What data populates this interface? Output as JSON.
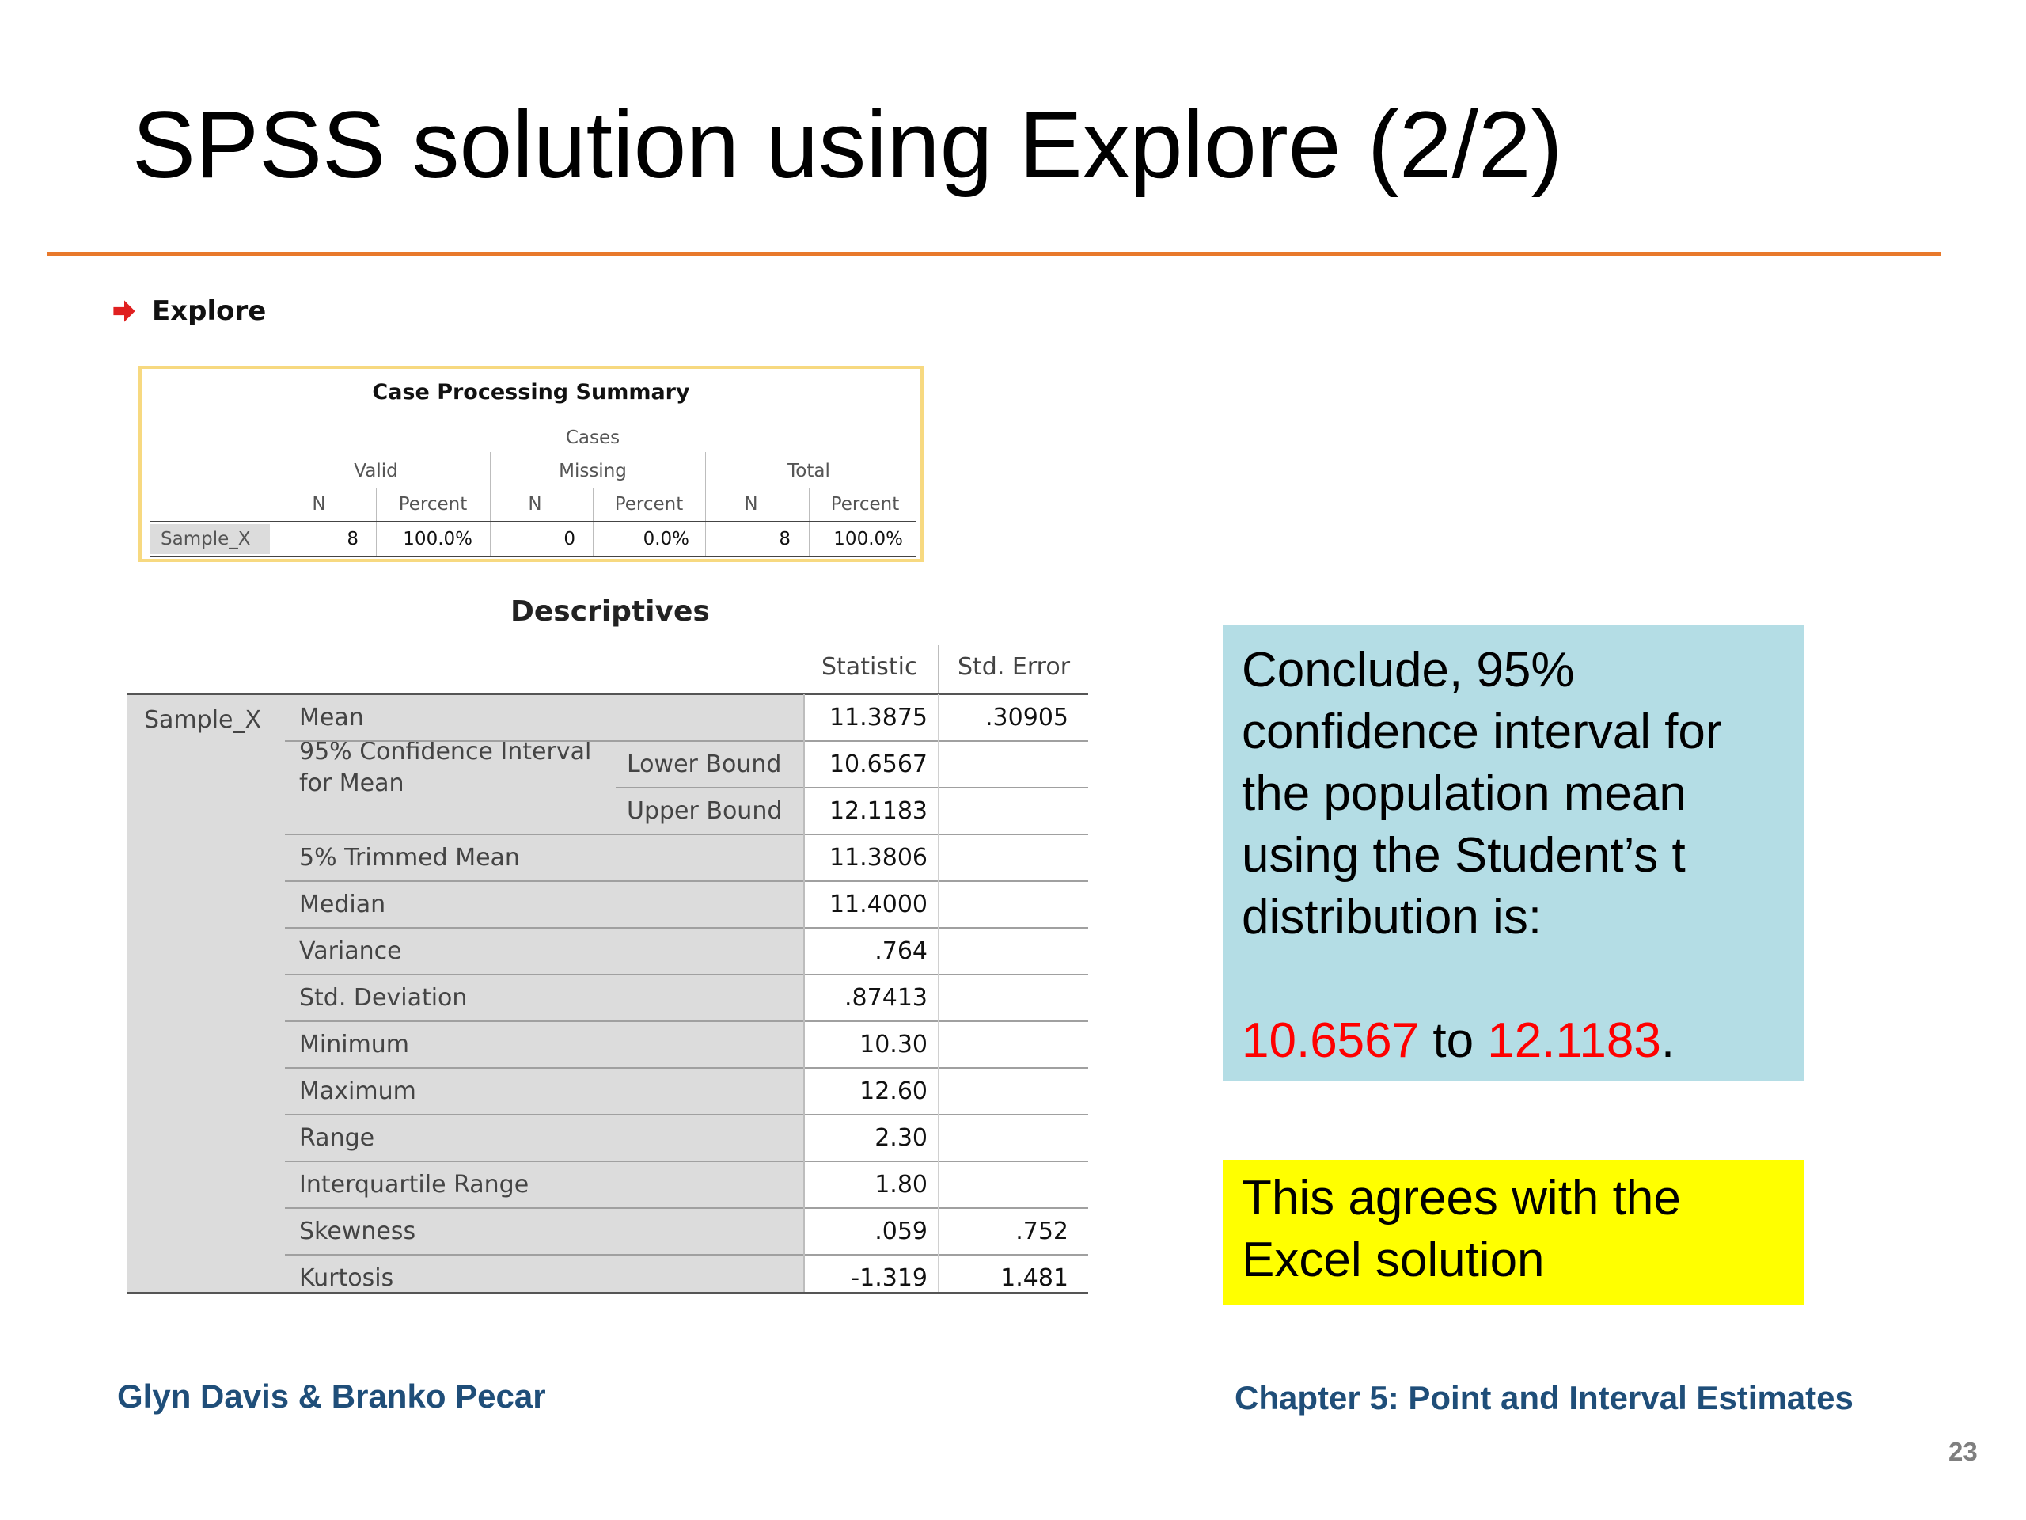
{
  "slide": {
    "title": "SPSS solution using Explore (2/2)",
    "accent_color": "#e8792b"
  },
  "explore": {
    "heading": "Explore",
    "icon": "red-arrow-icon"
  },
  "case_processing": {
    "title": "Case Processing Summary",
    "cases_label": "Cases",
    "groups": [
      "Valid",
      "Missing",
      "Total"
    ],
    "sub_headers": [
      "N",
      "Percent",
      "N",
      "Percent",
      "N",
      "Percent"
    ],
    "row_label": "Sample_X",
    "values": [
      "8",
      "100.0%",
      "0",
      "0.0%",
      "8",
      "100.0%"
    ]
  },
  "descriptives": {
    "title": "Descriptives",
    "col_statistic": "Statistic",
    "col_std_error": "Std. Error",
    "variable": "Sample_X",
    "ci_label_line1": "95% Confidence Interval",
    "ci_label_line2": "for Mean",
    "rows": [
      {
        "label": "Mean",
        "statistic": "11.3875",
        "std_error": ".30905"
      },
      {
        "label": "Lower Bound",
        "statistic": "10.6567",
        "std_error": ""
      },
      {
        "label": "Upper Bound",
        "statistic": "12.1183",
        "std_error": ""
      },
      {
        "label": "5% Trimmed Mean",
        "statistic": "11.3806",
        "std_error": ""
      },
      {
        "label": "Median",
        "statistic": "11.4000",
        "std_error": ""
      },
      {
        "label": "Variance",
        "statistic": ".764",
        "std_error": ""
      },
      {
        "label": "Std. Deviation",
        "statistic": ".87413",
        "std_error": ""
      },
      {
        "label": "Minimum",
        "statistic": "10.30",
        "std_error": ""
      },
      {
        "label": "Maximum",
        "statistic": "12.60",
        "std_error": ""
      },
      {
        "label": "Range",
        "statistic": "2.30",
        "std_error": ""
      },
      {
        "label": "Interquartile Range",
        "statistic": "1.80",
        "std_error": ""
      },
      {
        "label": "Skewness",
        "statistic": ".059",
        "std_error": ".752"
      },
      {
        "label": "Kurtosis",
        "statistic": "-1.319",
        "std_error": "1.481"
      }
    ]
  },
  "conclusion": {
    "text": "Conclude, 95% confidence interval for the population mean using the Student’s t distribution is:",
    "lower": "10.6567",
    "middle": " to ",
    "upper": "12.1183",
    "end": ".",
    "box_color": "#b4dde5",
    "highlight_color": "#ff0000"
  },
  "agreement": {
    "text": "This agrees with the Excel solution",
    "box_color": "#ffff00"
  },
  "footer": {
    "authors": "Glyn Davis & Branko Pecar",
    "chapter": "Chapter 5: Point and Interval Estimates",
    "page": "23"
  }
}
